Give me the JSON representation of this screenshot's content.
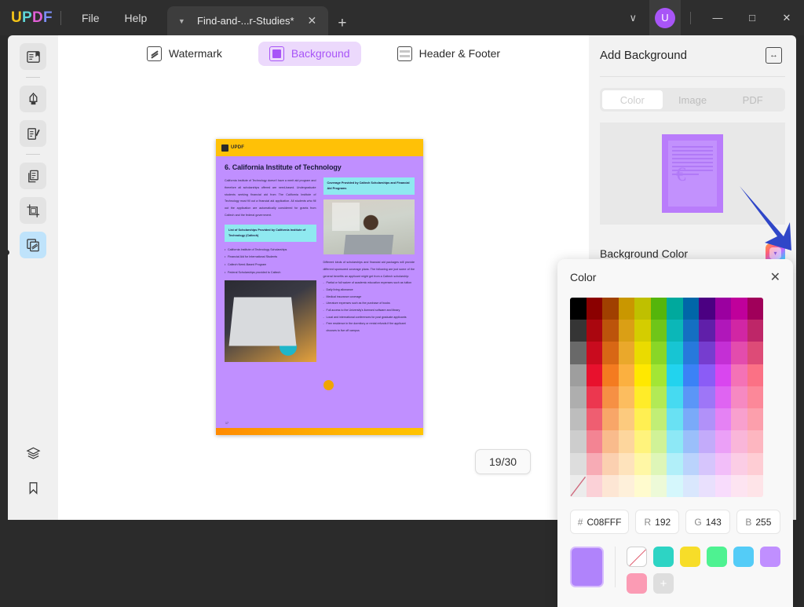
{
  "titlebar": {
    "logo": "UPDF",
    "menus": [
      "File",
      "Help"
    ],
    "tab": {
      "title": "Find-and-...r-Studies*",
      "caret": "chevron-down-icon",
      "close": "✕"
    },
    "new_tab": "+",
    "chevron": "∨",
    "avatar_initial": "U",
    "minimize": "—",
    "maximize": "□",
    "close": "✕"
  },
  "sidebar": {
    "items": [
      {
        "name": "sidebar-item-reader",
        "icon": "book-reader-icon",
        "state": "tinted"
      },
      {
        "name": "sidebar-item-divider-1",
        "icon": "divider",
        "state": "divider"
      },
      {
        "name": "sidebar-item-markup",
        "icon": "highlighter-pen-icon",
        "state": "tinted"
      },
      {
        "name": "sidebar-item-edit",
        "icon": "edit-document-icon",
        "state": "tinted"
      },
      {
        "name": "sidebar-item-divider-2",
        "icon": "divider",
        "state": "divider"
      },
      {
        "name": "sidebar-item-organize",
        "icon": "pages-copy-icon",
        "state": "tinted"
      },
      {
        "name": "sidebar-item-crop",
        "icon": "crop-icon",
        "state": "tinted"
      },
      {
        "name": "sidebar-item-background",
        "icon": "layers-watermark-icon",
        "state": "active"
      }
    ],
    "bottom_items": [
      {
        "name": "sidebar-item-layers",
        "icon": "layers-stack-icon"
      },
      {
        "name": "sidebar-item-bookmark",
        "icon": "bookmark-icon"
      }
    ]
  },
  "modebar": {
    "buttons": [
      {
        "label": "Watermark",
        "icon": "watermark-icon",
        "selected": false
      },
      {
        "label": "Background",
        "icon": "background-icon",
        "selected": true
      },
      {
        "label": "Header & Footer",
        "icon": "header-footer-icon",
        "selected": false
      }
    ]
  },
  "document": {
    "brand": "UPDF",
    "heading": "6. California Institute of Technology",
    "paragraph_left": "California Institute of Technology doesn't have a merit aid program and therefore all scholarships offered are need-based. Undergraduate students seeking financial aid from The California Institute of Technology must fill out a financial aid application. All students who fill out the application are automatically considered for grants from Caltech and the federal government.",
    "callout_left": "List of Scholarships Provided by California Institute of Technology (Caltech)",
    "bullets_left": [
      "California Institute of Technology Scholarships",
      "Financial Aid for International Students",
      "Caltech Need-Based Program",
      "Federal Scholarships provided to Caltech"
    ],
    "callout_right": "Coverage Provided by Caltech Scholarships and Financial Aid Programs",
    "paragraph_right": "Different kinds of scholarships and financial aid packages will provide different sponsored coverage plans. The following are just some of the general benefits an applicant might get from a Caltech scholarship:",
    "bullets_right": [
      "Partial or full waiver of academic education expenses such as tuition",
      "Daily living allowance",
      "Medical insurance coverage",
      "Literature expenses such as the purchase of books",
      "Full access to the University's licensed software and library",
      "Local and international conferences for post graduate applicants",
      "Free residence in the dormitory or rental refunds if the applicant chooses to live off campus"
    ],
    "page_footer": "17",
    "page_indicator": "19/30",
    "background_color": "#C08FFF"
  },
  "right_panel": {
    "title": "Add Background",
    "expand_icon": "document-resize-icon",
    "tabs": [
      {
        "label": "Color",
        "active": true
      },
      {
        "label": "Image",
        "active": false
      },
      {
        "label": "PDF",
        "active": false
      }
    ],
    "background_color_label": "Background Color",
    "color_button_icon": "rainbow-color-picker-icon",
    "annotation": "blue-arrow-pointer"
  },
  "color_dialog": {
    "title": "Color",
    "close_icon": "✕",
    "inputs": [
      {
        "key": "#",
        "value": "C08FFF",
        "name": "hex-input"
      },
      {
        "key": "R",
        "value": "192",
        "name": "red-input"
      },
      {
        "key": "G",
        "value": "143",
        "name": "green-input"
      },
      {
        "key": "B",
        "value": "255",
        "name": "blue-input"
      }
    ],
    "current_color": "#B083FB",
    "recent_swatches": [
      {
        "color": "none",
        "name": "no-color-swatch"
      },
      {
        "color": "#2DD4C4",
        "name": "teal-swatch"
      },
      {
        "color": "#F7DD29",
        "name": "yellow-swatch"
      },
      {
        "color": "#4EF291",
        "name": "green-swatch"
      },
      {
        "color": "#54CCF7",
        "name": "sky-swatch"
      },
      {
        "color": "#C08FFF",
        "name": "purple-swatch"
      },
      {
        "color": "#FB9BB4",
        "name": "pink-swatch"
      },
      {
        "color": "plus",
        "name": "add-color-swatch"
      }
    ],
    "palette": {
      "columns": 12,
      "rows": 9,
      "hues": [
        "#000000",
        "#8B0000",
        "#A04000",
        "#C99700",
        "#BFC000",
        "#55B50B",
        "#00A99D",
        "#0066A8",
        "#4B0082",
        "#9B00A0",
        "#C0009B",
        "#A0005A"
      ],
      "base_row": [
        "#9e9e9e",
        "#E8112D",
        "#F47B20",
        "#FBB040",
        "#FFE800",
        "#A3E635",
        "#22D3EE",
        "#3B82F6",
        "#8B5CF6",
        "#D946EF",
        "#F472B6",
        "#FB7185"
      ]
    }
  }
}
